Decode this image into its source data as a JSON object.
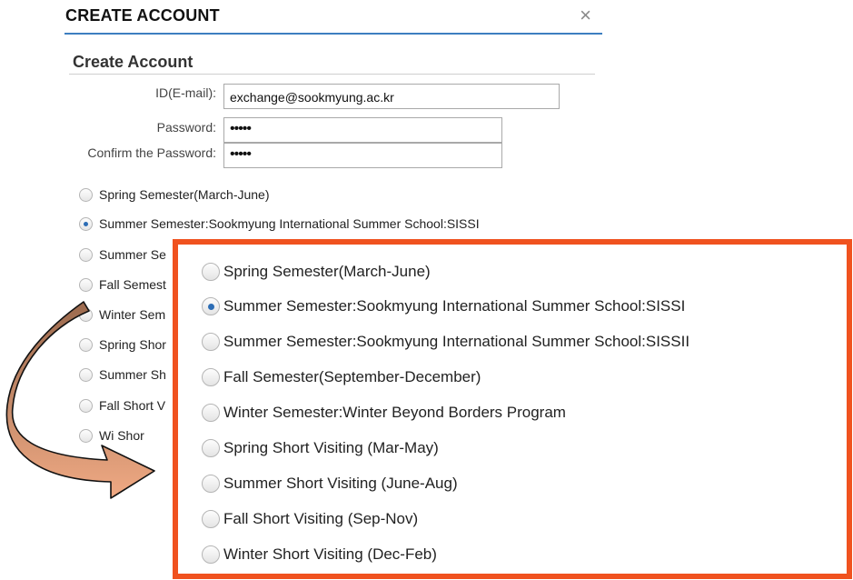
{
  "dialog": {
    "title": "CREATE ACCOUNT",
    "close_glyph": "×"
  },
  "form": {
    "section_title": "Create Account",
    "id_label": "ID(E-mail):",
    "id_value": "exchange@sookmyung.ac.kr",
    "password_label": "Password:",
    "password_value": "•••••",
    "confirm_label": "Confirm the Password:",
    "confirm_value": "•••••"
  },
  "options_visible": [
    {
      "label": "Spring Semester(March-June)",
      "checked": false
    },
    {
      "label": "Summer Semester:Sookmyung International Summer School:SISSI",
      "checked": true
    },
    {
      "label": "Summer Se",
      "checked": false
    },
    {
      "label": "Fall Semest",
      "checked": false
    },
    {
      "label": "Winter Sem",
      "checked": false
    },
    {
      "label": "Spring Shor",
      "checked": false
    },
    {
      "label": "Summer Sh",
      "checked": false
    },
    {
      "label": "Fall Short V",
      "checked": false
    },
    {
      "label": "Wi  Shor",
      "checked": false
    }
  ],
  "zoom_options": [
    {
      "label": "Spring Semester(March-June)",
      "checked": false
    },
    {
      "label": "Summer Semester:Sookmyung International Summer School:SISSI",
      "checked": true
    },
    {
      "label": "Summer Semester:Sookmyung International Summer School:SISSII",
      "checked": false
    },
    {
      "label": "Fall Semester(September-December)",
      "checked": false
    },
    {
      "label": "Winter Semester:Winter Beyond Borders Program",
      "checked": false
    },
    {
      "label": "Spring Short Visiting (Mar-May)",
      "checked": false
    },
    {
      "label": "Summer Short Visiting (June-Aug)",
      "checked": false
    },
    {
      "label": "Fall Short Visiting (Sep-Nov)",
      "checked": false
    },
    {
      "label": "Winter Short Visiting (Dec-Feb)",
      "checked": false
    }
  ],
  "colors": {
    "accent": "#3d7ec0",
    "highlight_border": "#f0521f",
    "arrow_dark": "#9c6a4e",
    "arrow_light": "#f0a983"
  }
}
